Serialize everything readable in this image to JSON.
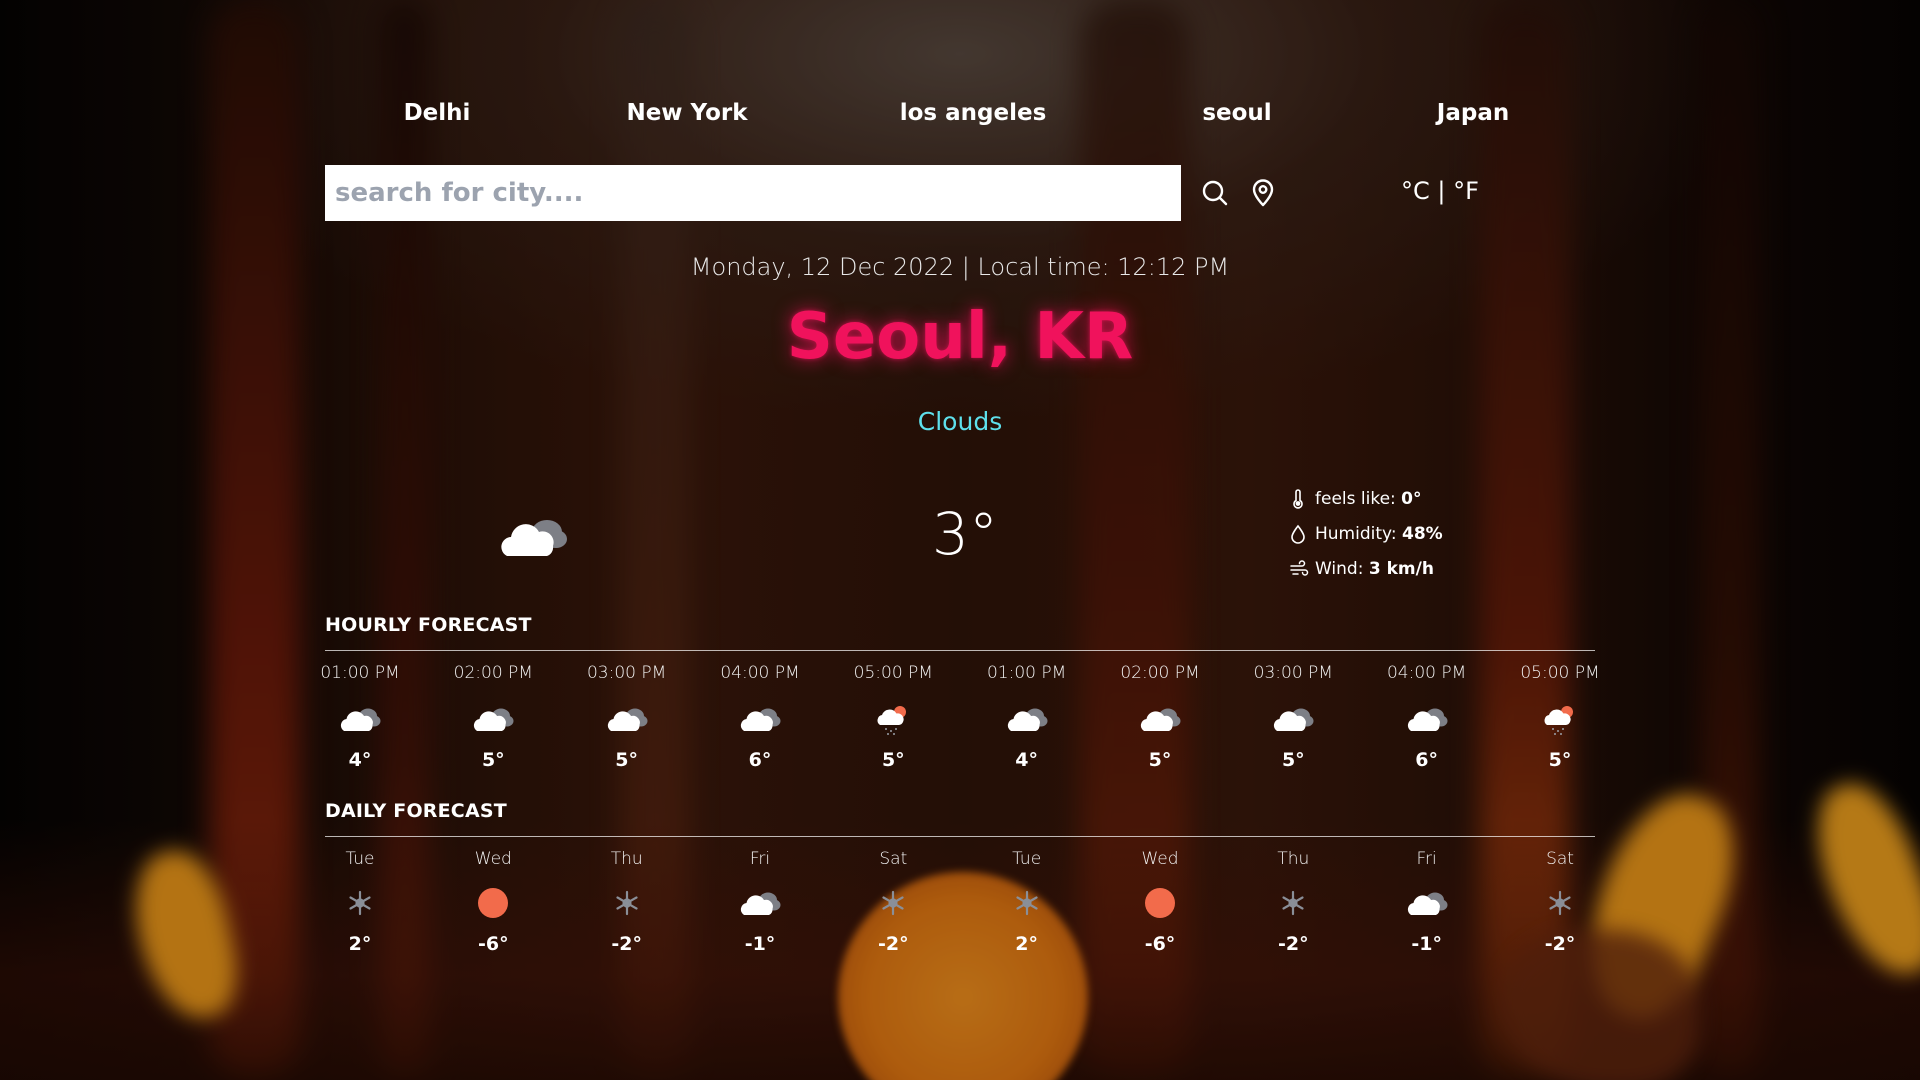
{
  "nav": {
    "cities": [
      "Delhi",
      "New York",
      "los angeles",
      "seoul",
      "Japan"
    ]
  },
  "search": {
    "placeholder": "search for city....",
    "value": "",
    "search_icon": "search-icon",
    "location_icon": "location-pin-icon"
  },
  "units": {
    "celsius": "°C",
    "separator": "|",
    "fahrenheit": "°F"
  },
  "current": {
    "datetime": "Monday, 12 Dec 2022 | Local time: 12:12 PM",
    "city": "Seoul, KR",
    "condition": "Clouds",
    "icon": "cloudy-icon",
    "temperature": "3°",
    "details": [
      {
        "icon": "thermometer-icon",
        "label": "feels like: ",
        "value": "0°"
      },
      {
        "icon": "droplet-icon",
        "label": "Humidity: ",
        "value": "48%"
      },
      {
        "icon": "wind-icon",
        "label": "Wind: ",
        "value": "3 km/h"
      }
    ]
  },
  "hourly": {
    "title": "HOURLY FORECAST",
    "items": [
      {
        "time": "01:00 PM",
        "icon": "cloudy",
        "temp": "4°"
      },
      {
        "time": "02:00 PM",
        "icon": "cloudy",
        "temp": "5°"
      },
      {
        "time": "03:00 PM",
        "icon": "cloudy",
        "temp": "5°"
      },
      {
        "time": "04:00 PM",
        "icon": "cloudy",
        "temp": "6°"
      },
      {
        "time": "05:00 PM",
        "icon": "sun-snow",
        "temp": "5°"
      },
      {
        "time": "01:00 PM",
        "icon": "cloudy",
        "temp": "4°"
      },
      {
        "time": "02:00 PM",
        "icon": "cloudy",
        "temp": "5°"
      },
      {
        "time": "03:00 PM",
        "icon": "cloudy",
        "temp": "5°"
      },
      {
        "time": "04:00 PM",
        "icon": "cloudy",
        "temp": "6°"
      },
      {
        "time": "05:00 PM",
        "icon": "sun-snow",
        "temp": "5°"
      }
    ]
  },
  "daily": {
    "title": "DAILY FORECAST",
    "items": [
      {
        "day": "Tue",
        "icon": "snow",
        "temp": "2°"
      },
      {
        "day": "Wed",
        "icon": "sun",
        "temp": "-6°"
      },
      {
        "day": "Thu",
        "icon": "snow",
        "temp": "-2°"
      },
      {
        "day": "Fri",
        "icon": "cloudy",
        "temp": "-1°"
      },
      {
        "day": "Sat",
        "icon": "snow",
        "temp": "-2°"
      },
      {
        "day": "Tue",
        "icon": "snow",
        "temp": "2°"
      },
      {
        "day": "Wed",
        "icon": "sun",
        "temp": "-6°"
      },
      {
        "day": "Thu",
        "icon": "snow",
        "temp": "-2°"
      },
      {
        "day": "Fri",
        "icon": "cloudy",
        "temp": "-1°"
      },
      {
        "day": "Sat",
        "icon": "snow",
        "temp": "-2°"
      }
    ]
  },
  "colors": {
    "city_title": "#f0125c",
    "condition": "#5ee0ec",
    "sun": "#f26b4b"
  }
}
